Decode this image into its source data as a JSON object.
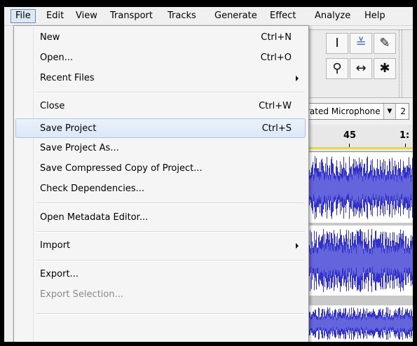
{
  "menubar": {
    "items": [
      "File",
      "Edit",
      "View",
      "Transport",
      "Tracks",
      "Generate",
      "Effect",
      "Analyze",
      "Help"
    ]
  },
  "toolbar": {
    "tools": {
      "ibeam": "I",
      "zoom": "⚲",
      "timeshift": "↔",
      "multi": "✱",
      "pencil": "✎",
      "envelope": "≚"
    },
    "input_device": "rated Microphone",
    "input_device_arrow": "▼",
    "channels_partial": "2"
  },
  "ruler": {
    "ticks": [
      "45",
      "1:"
    ]
  },
  "file_menu": {
    "items": [
      {
        "label": "New",
        "shortcut": "Ctrl+N"
      },
      {
        "label": "Open...",
        "shortcut": "Ctrl+O"
      },
      {
        "label": "Recent Files",
        "shortcut": ""
      },
      {
        "label": "Close",
        "shortcut": "Ctrl+W"
      },
      {
        "label": "Save Project",
        "shortcut": "Ctrl+S"
      },
      {
        "label": "Save Project As...",
        "shortcut": ""
      },
      {
        "label": "Save Compressed Copy of Project...",
        "shortcut": ""
      },
      {
        "label": "Check Dependencies...",
        "shortcut": ""
      },
      {
        "label": "Open Metadata Editor...",
        "shortcut": ""
      },
      {
        "label": "Import",
        "shortcut": ""
      },
      {
        "label": "Export...",
        "shortcut": ""
      },
      {
        "label": "Export Selection...",
        "shortcut": ""
      }
    ],
    "highlighted": "Save Project",
    "disabled": [
      "Export Selection..."
    ]
  },
  "colors": {
    "waveform_dark": "#3232c8",
    "waveform_light": "#6464dc",
    "menu_highlight": "#dbe8f7",
    "selection_line": "#e6d84a"
  }
}
